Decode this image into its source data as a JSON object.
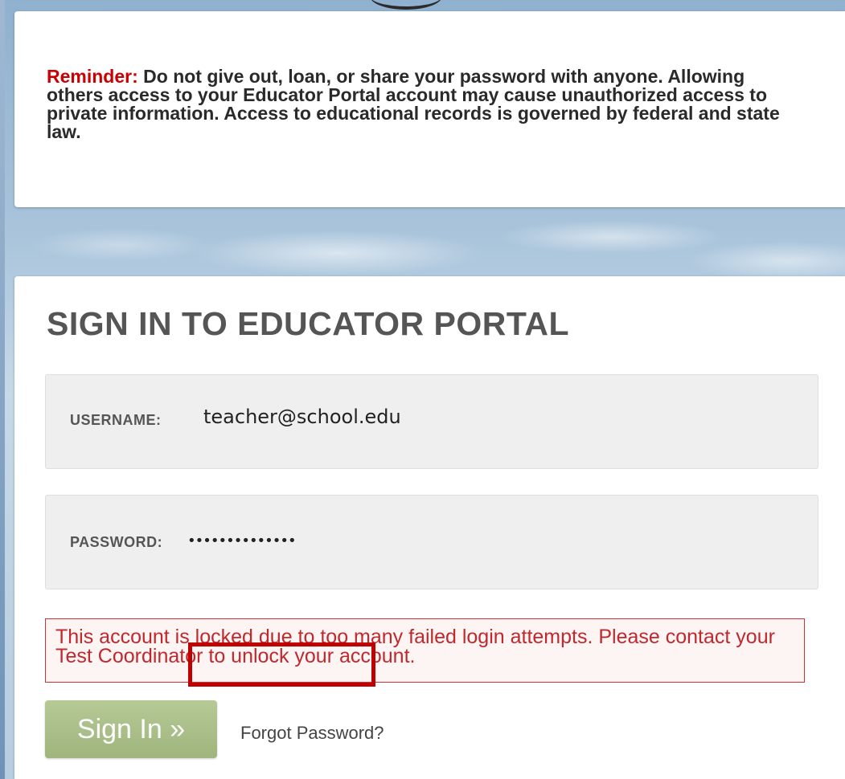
{
  "reminder": {
    "label": "Reminder:",
    "message": " Do not give out, loan, or share your password with anyone. Allowing others access to your Educator Portal account may cause unauthorized access to private information. Access to educational records is governed by federal and state law."
  },
  "signin": {
    "title": "SIGN IN TO EDUCATOR PORTAL",
    "username_label": "USERNAME:",
    "username_value": "teacher@school.edu",
    "password_label": "PASSWORD:",
    "password_value": "••••••••••••••",
    "error_before": "This account is locked due to too many failed login attempts. Please contact your ",
    "error_link": "Test Coordinator",
    "error_after": " to unlock your account.",
    "button_label": "Sign In »",
    "forgot_label": "Forgot Password?"
  },
  "colors": {
    "error": "#c0282d",
    "highlight": "#c00000",
    "button": "#a8bd88"
  }
}
